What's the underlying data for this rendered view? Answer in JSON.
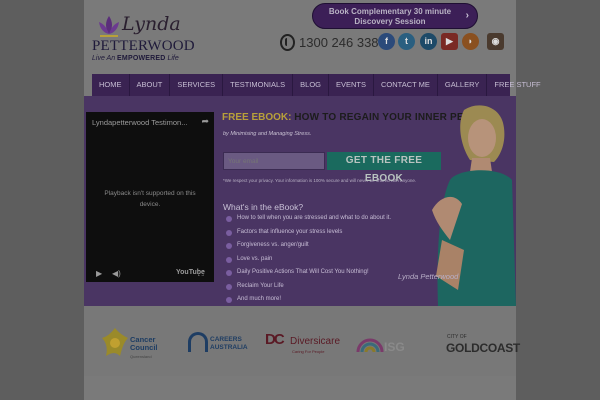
{
  "header": {
    "logo_script": "Lynda",
    "logo_surname": "PETTERWOOD",
    "logo_tagline_prefix": "Live An",
    "logo_tagline_bold": "EMPOWERED",
    "logo_tagline_suffix": "Life",
    "cta_label": "Book Complementary 30 minute Discovery Session",
    "phone": "1300 246 338",
    "social_icons": [
      "facebook-icon",
      "twitter-icon",
      "linkedin-icon",
      "youtube-icon",
      "rss-icon",
      "instagram-icon"
    ]
  },
  "nav": {
    "items": [
      "HOME",
      "ABOUT",
      "SERVICES",
      "TESTIMONIALS",
      "BLOG",
      "EVENTS",
      "CONTACT ME",
      "GALLERY",
      "FREE STUFF"
    ]
  },
  "video": {
    "title": "Lyndapetterwood Testimon...",
    "message": "Playback isn't supported on this device.",
    "brand": "YouTube"
  },
  "ebook": {
    "title_prefix": "FREE EBOOK:",
    "title_rest": "HOW TO REGAIN YOUR INNER PEACE",
    "subtitle": "by Minimising and Managing Stress.",
    "email_placeholder": "Your email",
    "button_label": "GET THE FREE EBOOK",
    "privacy": "*We respect your privacy. Your information is 100% secure and will never be shared with anyone.",
    "section_heading": "What's in the eBook?",
    "bullets": [
      "How to tell when you are stressed and what to do about it.",
      "Factors that influence your stress levels",
      "Forgiveness vs. anger/guilt",
      "Love vs. pain",
      "Daily Positive Actions That Will Cost You Nothing!",
      "Reclaim Your Life",
      "And much more!"
    ],
    "signature": "Lynda Petterwood"
  },
  "partners": {
    "cancer_council_line1": "Cancer",
    "cancer_council_line2": "Council",
    "cancer_council_line3": "Queensland",
    "careers_line1": "CAREERS",
    "careers_line2": "AUSTRALIA",
    "diversicare_mark": "DC",
    "diversicare": "Diversicare",
    "diversicare_sub": "Caring For People",
    "rainbow_text": "ISG",
    "gold_coast_small": "CITY OF",
    "gold_coast": "GOLDCOAST"
  },
  "colors": {
    "purple_dark": "#3a2352",
    "purple_banner": "#4a3563",
    "teal_button": "#1a6a5e",
    "gold_text": "#b8a03a"
  }
}
